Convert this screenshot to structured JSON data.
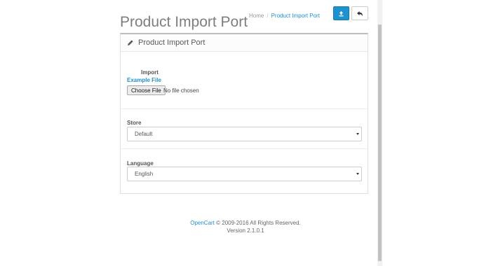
{
  "header": {
    "title": "Product Import Port",
    "breadcrumb": {
      "home": "Home",
      "separator": "/",
      "current": "Product Import Port"
    }
  },
  "toolbar": {
    "upload_icon": "upload-icon",
    "back_icon": "reply-icon"
  },
  "panel": {
    "title": "Product Import Port",
    "icon": "pencil-icon",
    "import_label": "Import",
    "example_link": "Example File",
    "choose_file_label": "Choose File",
    "file_status": "No file chosen",
    "store": {
      "label": "Store",
      "selected": "Default"
    },
    "language": {
      "label": "Language",
      "selected": "English"
    }
  },
  "footer": {
    "brand": "OpenCart",
    "copyright": "© 2009-2016 All Rights Reserved.",
    "version": "Version 2.1.0.1"
  },
  "colors": {
    "accent": "#1e91cf",
    "title": "#7e7e7e"
  }
}
